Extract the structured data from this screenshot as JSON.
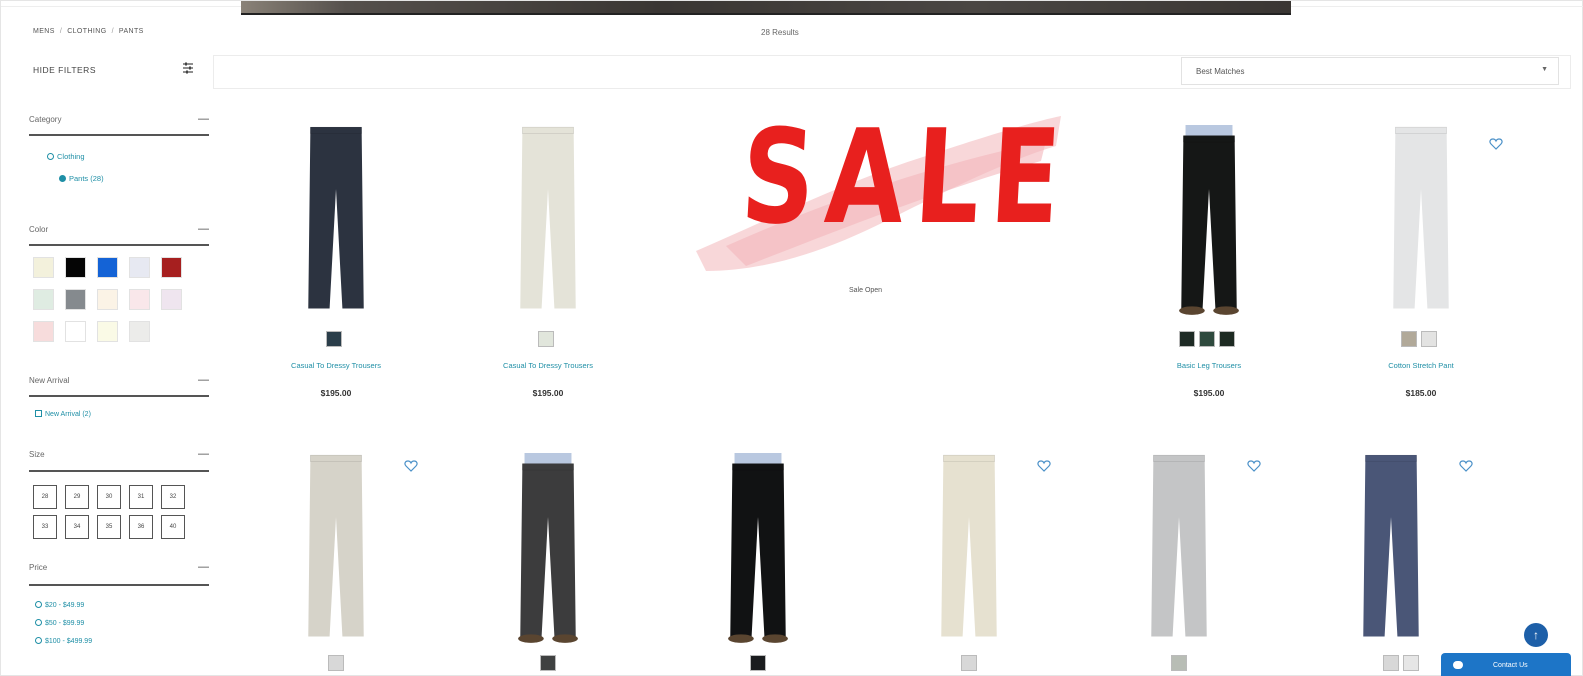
{
  "breadcrumb": [
    "MENS",
    "CLOTHING",
    "PANTS"
  ],
  "results_text": "28 Results",
  "filters": {
    "hide_label": "HIDE FILTERS",
    "sort_selected": "Best Matches"
  },
  "facets": {
    "category": {
      "title": "Category",
      "items": [
        "Clothing",
        "Pants (28)"
      ]
    },
    "color": {
      "title": "Color",
      "swatches": [
        "#f3f1dc",
        "#050505",
        "#1463d6",
        "#e7e9f2",
        "#a61f1f",
        "#dfece2",
        "#858a8e",
        "#fbf3e6",
        "#f9e7ea",
        "#efe5ef",
        "#f7dcdc",
        "#ffffff",
        "#fafae6",
        "#ececea"
      ]
    },
    "new_arrival": {
      "title": "New Arrival",
      "option": "New Arrival (2)"
    },
    "size": {
      "title": "Size",
      "values": [
        "28",
        "29",
        "30",
        "31",
        "32",
        "33",
        "34",
        "35",
        "36",
        "40"
      ]
    },
    "price": {
      "title": "Price",
      "options": [
        "$20 - $49.99",
        "$50 - $99.99",
        "$100 - $499.99"
      ]
    }
  },
  "sale_banner": {
    "text": "SALE",
    "caption": "Sale Open"
  },
  "products_row1": [
    {
      "name": "Casual To Dressy Trousers",
      "price": "$195.00",
      "pant_color": "#2c3340",
      "chips": [
        "#2b3e4a"
      ]
    },
    {
      "name": "Casual To Dressy Trousers",
      "price": "$195.00",
      "pant_color": "#e4e3d8",
      "chips": [
        "#e1e6dc"
      ]
    },
    {
      "name": "Basic Leg Trousers",
      "price": "$195.00",
      "pant_color": "#151716",
      "chips": [
        "#1e2b25",
        "#2f4a3e",
        "#1d2a22"
      ]
    },
    {
      "name": "Cotton Stretch Pant",
      "price": "$185.00",
      "pant_color": "#e4e5e6",
      "chips": [
        "#b1a999",
        "#e3e3e2"
      ]
    }
  ],
  "products_row2": [
    {
      "pant_color": "#d6d3c9",
      "chip": "#d8d8d8"
    },
    {
      "pant_color": "#3c3c3d",
      "chip": "#3f4141"
    },
    {
      "pant_color": "#111213",
      "chip": "#1a1c1e"
    },
    {
      "pant_color": "#e6e1d0",
      "chip": "#d8d8d8"
    },
    {
      "pant_color": "#c4c5c6",
      "chip": "#b8bdb5"
    },
    {
      "pant_color": "#4a5677",
      "chip": "#d8d8d8"
    }
  ],
  "contact_label": "Contact Us",
  "colors": {
    "accent": "#1f8fa6",
    "sale_red": "#e8201e",
    "contact_blue": "#1d75c7"
  }
}
